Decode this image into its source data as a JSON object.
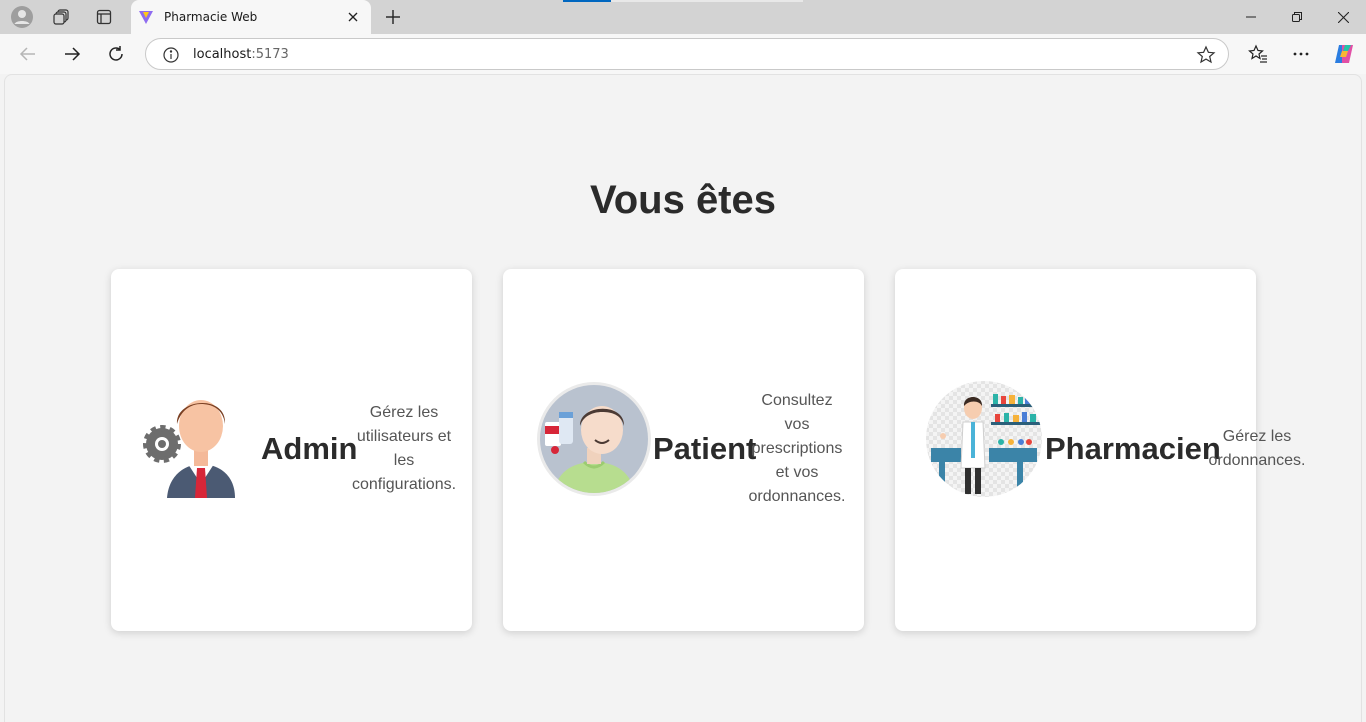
{
  "browser": {
    "tab_title": "Pharmacie Web",
    "url_host": "localhost",
    "url_port": ":5173",
    "icons": [
      "profile-icon",
      "workspaces-icon",
      "tab-actions-icon",
      "close-icon",
      "new-tab-icon",
      "minimize-icon",
      "restore-icon",
      "window-close-icon",
      "back-icon",
      "forward-icon",
      "refresh-icon",
      "info-icon",
      "favorite-star-icon",
      "favorites-icon",
      "more-icon",
      "copilot-icon"
    ]
  },
  "page": {
    "title": "Vous êtes",
    "cards": [
      {
        "role": "Admin",
        "desc": "Gérez les utilisateurs et les configurations.",
        "icon": "admin-avatar-icon"
      },
      {
        "role": "Patient",
        "desc": "Consultez vos prescriptions et vos ordonnances.",
        "icon": "patient-avatar-icon"
      },
      {
        "role": "Pharmacien",
        "desc": "Gérez les ordonnances.",
        "icon": "pharmacist-avatar-icon"
      }
    ]
  },
  "colors": {
    "page_bg": "#f3f3f3",
    "card_bg": "#ffffff",
    "title_text": "#2b2b2b",
    "accent": "#0067c0"
  }
}
